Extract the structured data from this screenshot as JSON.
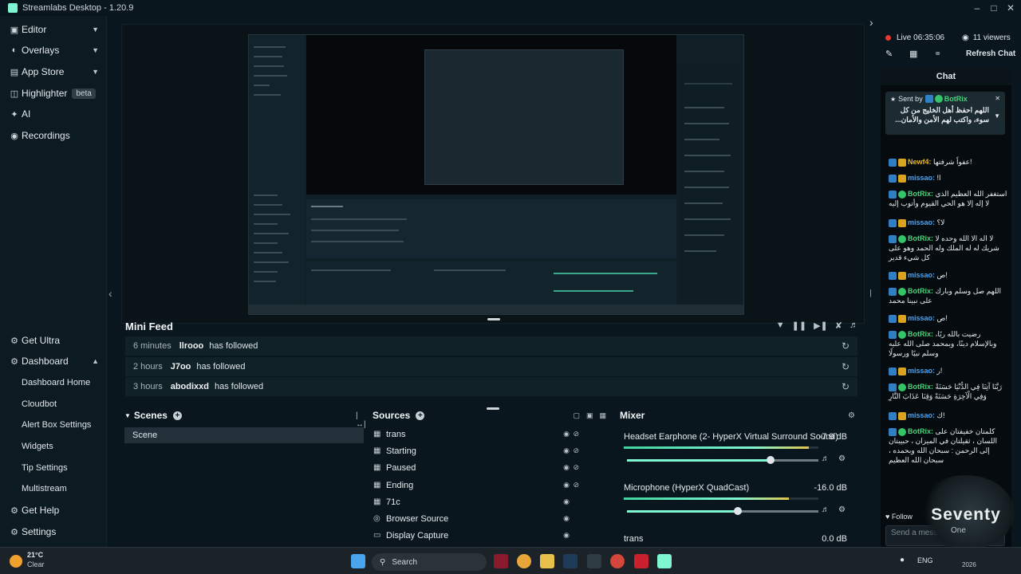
{
  "app": {
    "title": "Streamlabs Desktop - 1.20.9"
  },
  "sidebar": {
    "items": [
      {
        "label": "Editor"
      },
      {
        "label": "Overlays"
      },
      {
        "label": "App Store"
      },
      {
        "label": "Highlighter",
        "badge": "beta"
      },
      {
        "label": "AI"
      },
      {
        "label": "Recordings"
      }
    ],
    "bottom": {
      "get_ultra": "Get Ultra",
      "dashboard": "Dashboard",
      "dashboard_sub": [
        "Dashboard Home",
        "Cloudbot",
        "Alert Box Settings",
        "Widgets",
        "Tip Settings",
        "Multistream"
      ],
      "get_help": "Get Help",
      "settings": "Settings"
    }
  },
  "mini_feed": {
    "title": "Mini Feed",
    "rows": [
      {
        "time": "6 minutes",
        "user": "llrooo",
        "action": "has followed"
      },
      {
        "time": "2 hours",
        "user": "J7oo",
        "action": "has followed"
      },
      {
        "time": "3 hours",
        "user": "abodixxd",
        "action": "has followed"
      }
    ]
  },
  "scenes": {
    "title": "Scenes",
    "items": [
      "Scene"
    ]
  },
  "sources": {
    "title": "Sources",
    "items": [
      "trans",
      "Starting",
      "Paused",
      "Ending",
      "71c",
      "Browser Source",
      "Display Capture"
    ]
  },
  "mixer": {
    "title": "Mixer",
    "channels": [
      {
        "name": "Headset Earphone (2- HyperX Virtual Surround Sound)",
        "db": "-7.9 dB",
        "level": 0.95,
        "volume": 0.75
      },
      {
        "name": "Microphone (HyperX QuadCast)",
        "db": "-16.0 dB",
        "level": 0.85,
        "volume": 0.58
      },
      {
        "name": "trans",
        "db": "0.0 dB",
        "level": 0,
        "volume": 1
      }
    ]
  },
  "live": {
    "status": "Live",
    "time": "06:35:06",
    "viewers": "11 viewers",
    "refresh": "Refresh Chat"
  },
  "chat": {
    "title": "Chat",
    "pinned": {
      "prefix": "Sent by",
      "user": "BotRix",
      "text": "اللهم احفظ أهل الخليج من كل سوء، واكتب لهم الأمن والأمان..."
    },
    "messages": [
      {
        "user": "Newf4",
        "color": "#e8b52c",
        "text": "عفواً شرفتها!"
      },
      {
        "user": "missao",
        "color": "#4aa3f0",
        "text": "!ا"
      },
      {
        "user": "BotRix",
        "color": "#46d47a",
        "text": "استغفر الله العظيم الذي لا إله إلا هو الحي القيوم وأتوب إليه"
      },
      {
        "user": "missao",
        "color": "#4aa3f0",
        "text": "لا؟"
      },
      {
        "user": "BotRix",
        "color": "#46d47a",
        "text": "لا اله الا الله وحده لا شريك له له الملك وله الحمد وهو على كل شيء قدير"
      },
      {
        "user": "missao",
        "color": "#4aa3f0",
        "text": "ص!"
      },
      {
        "user": "BotRix",
        "color": "#46d47a",
        "text": "اللهم صل وسلم وبارك على نبينا محمد"
      },
      {
        "user": "missao",
        "color": "#4aa3f0",
        "text": "ص!"
      },
      {
        "user": "BotRix",
        "color": "#46d47a",
        "text": "رضيت بالله ربًا، وبالإسلام دينًا، وبمحمد صلى الله عليه وسلم نبيًا ورسولًا"
      },
      {
        "user": "missao",
        "color": "#4aa3f0",
        "text": "ر!"
      },
      {
        "user": "BotRix",
        "color": "#46d47a",
        "text": "رَبَّنَا آتِنَا فِي الدُّنْيَا حَسَنَةً وَفِي الْآخِرَةِ حَسَنَةً وَقِنَا عَذَابَ النَّارِ"
      },
      {
        "user": "missao",
        "color": "#4aa3f0",
        "text": "ك!"
      },
      {
        "user": "BotRix",
        "color": "#46d47a",
        "text": "كلمتان خفيفتان على اللسان ، ثقيلتان في الميزان ، حبيبتان إلى الرحمن : سبحان الله وبحمده ، سبحان الله العظيم"
      }
    ],
    "follow": "Follow",
    "input_placeholder": "Send a message"
  },
  "watermark": {
    "text": "Seventy",
    "sub": "One"
  },
  "taskbar": {
    "weather_temp": "21°C",
    "weather_desc": "Clear",
    "search": "Search",
    "lang": "ENG",
    "year": "2026"
  },
  "preview_inner": {
    "title": "Streamlabs Desktop - 1.20.9",
    "feed": "Mini Feed"
  }
}
